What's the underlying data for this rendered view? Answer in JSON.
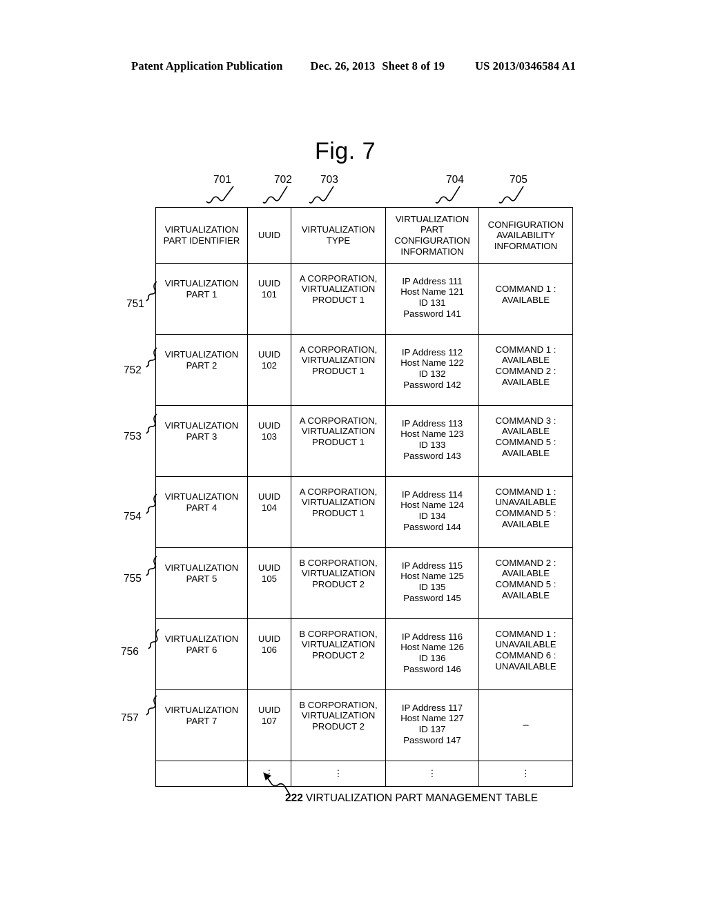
{
  "header": {
    "publication": "Patent Application Publication",
    "date": "Dec. 26, 2013",
    "sheet": "Sheet 8 of 19",
    "patent_number": "US 2013/0346584 A1"
  },
  "figure": {
    "title": "Fig. 7"
  },
  "column_refs": [
    {
      "id": "701",
      "target": "virtualization-part-identifier"
    },
    {
      "id": "702",
      "target": "uuid"
    },
    {
      "id": "703",
      "target": "virtualization-type"
    },
    {
      "id": "704",
      "target": "virtualization-part-configuration-information"
    },
    {
      "id": "705",
      "target": "configuration-availability-information"
    }
  ],
  "table": {
    "headers": [
      {
        "lines": [
          "VIRTUALIZATION",
          "PART IDENTIFIER"
        ]
      },
      {
        "lines": [
          "UUID"
        ]
      },
      {
        "lines": [
          "VIRTUALIZATION",
          "TYPE"
        ]
      },
      {
        "lines": [
          "VIRTUALIZATION",
          "PART",
          "CONFIGURATION",
          "INFORMATION"
        ]
      },
      {
        "lines": [
          "CONFIGURATION",
          "AVAILABILITY",
          "INFORMATION"
        ]
      }
    ],
    "rows": [
      {
        "ref": "751",
        "identifier": [
          "VIRTUALIZATION",
          "PART 1"
        ],
        "uuid": [
          "UUID",
          "101"
        ],
        "type": [
          "A CORPORATION,",
          "VIRTUALIZATION",
          "PRODUCT 1"
        ],
        "config": [
          "IP Address 111",
          "Host Name 121",
          "ID 131",
          "Password 141"
        ],
        "availability": [
          "COMMAND 1 :",
          "AVAILABLE"
        ]
      },
      {
        "ref": "752",
        "identifier": [
          "VIRTUALIZATION",
          "PART 2"
        ],
        "uuid": [
          "UUID",
          "102"
        ],
        "type": [
          "A CORPORATION,",
          "VIRTUALIZATION",
          "PRODUCT 1"
        ],
        "config": [
          "IP Address 112",
          "Host Name 122",
          "ID 132",
          "Password 142"
        ],
        "availability": [
          "COMMAND 1 :",
          "AVAILABLE",
          "COMMAND 2 :",
          "AVAILABLE"
        ]
      },
      {
        "ref": "753",
        "identifier": [
          "VIRTUALIZATION",
          "PART 3"
        ],
        "uuid": [
          "UUID",
          "103"
        ],
        "type": [
          "A CORPORATION,",
          "VIRTUALIZATION",
          "PRODUCT 1"
        ],
        "config": [
          "IP Address 113",
          "Host Name 123",
          "ID 133",
          "Password 143"
        ],
        "availability": [
          "COMMAND 3 :",
          "AVAILABLE",
          "COMMAND 5 :",
          "AVAILABLE"
        ]
      },
      {
        "ref": "754",
        "identifier": [
          "VIRTUALIZATION",
          "PART 4"
        ],
        "uuid": [
          "UUID",
          "104"
        ],
        "type": [
          "A CORPORATION,",
          "VIRTUALIZATION",
          "PRODUCT 1"
        ],
        "config": [
          "IP Address 114",
          "Host Name 124",
          "ID 134",
          "Password 144"
        ],
        "availability": [
          "COMMAND 1 :",
          "UNAVAILABLE",
          "COMMAND 5 :",
          "AVAILABLE"
        ]
      },
      {
        "ref": "755",
        "identifier": [
          "VIRTUALIZATION",
          "PART 5"
        ],
        "uuid": [
          "UUID",
          "105"
        ],
        "type": [
          "B CORPORATION,",
          "VIRTUALIZATION",
          "PRODUCT 2"
        ],
        "config": [
          "IP Address 115",
          "Host Name 125",
          "ID 135",
          "Password 145"
        ],
        "availability": [
          "COMMAND 2 :",
          "AVAILABLE",
          "COMMAND 5 :",
          "AVAILABLE"
        ]
      },
      {
        "ref": "756",
        "identifier": [
          "VIRTUALIZATION",
          "PART 6"
        ],
        "uuid": [
          "UUID",
          "106"
        ],
        "type": [
          "B CORPORATION,",
          "VIRTUALIZATION",
          "PRODUCT 2"
        ],
        "config": [
          "IP Address 116",
          "Host Name 126",
          "ID 136",
          "Password 146"
        ],
        "availability": [
          "COMMAND 1 :",
          "UNAVAILABLE",
          "COMMAND 6 :",
          "UNAVAILABLE"
        ]
      },
      {
        "ref": "757",
        "identifier": [
          "VIRTUALIZATION",
          "PART 7"
        ],
        "uuid": [
          "UUID",
          "107"
        ],
        "type": [
          "B CORPORATION,",
          "VIRTUALIZATION",
          "PRODUCT 2"
        ],
        "config": [
          "IP Address 117",
          "Host Name 127",
          "ID 137",
          "Password 147"
        ],
        "availability": [
          "–"
        ]
      }
    ],
    "continuation_row": {
      "identifier": "",
      "uuid": "⋮",
      "type": "⋮",
      "config": "⋮",
      "availability": "⋮"
    }
  },
  "caption": {
    "number": "222",
    "text": "VIRTUALIZATION PART MANAGEMENT TABLE"
  }
}
